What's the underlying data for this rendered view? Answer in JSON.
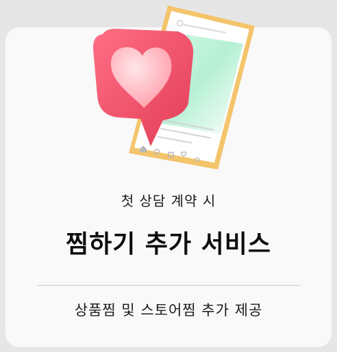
{
  "card": {
    "subtitle": "첫 상담 계약 시",
    "title": "찜하기 추가 서비스",
    "description": "상품찜 및 스토어찜 추가 제공"
  },
  "colors": {
    "page_background": "#e6e6e6",
    "card_background": "#f9f9f9",
    "heart_bubble": "#f0566f",
    "heart": "#ffc7cd",
    "phone_frame": "#f4c46b",
    "phone_screen_accent": "#b5f0d4"
  },
  "icons": [
    "heart-bubble-icon",
    "smartphone-icon",
    "home-icon",
    "search-icon",
    "add-icon",
    "heart-icon",
    "profile-icon"
  ]
}
